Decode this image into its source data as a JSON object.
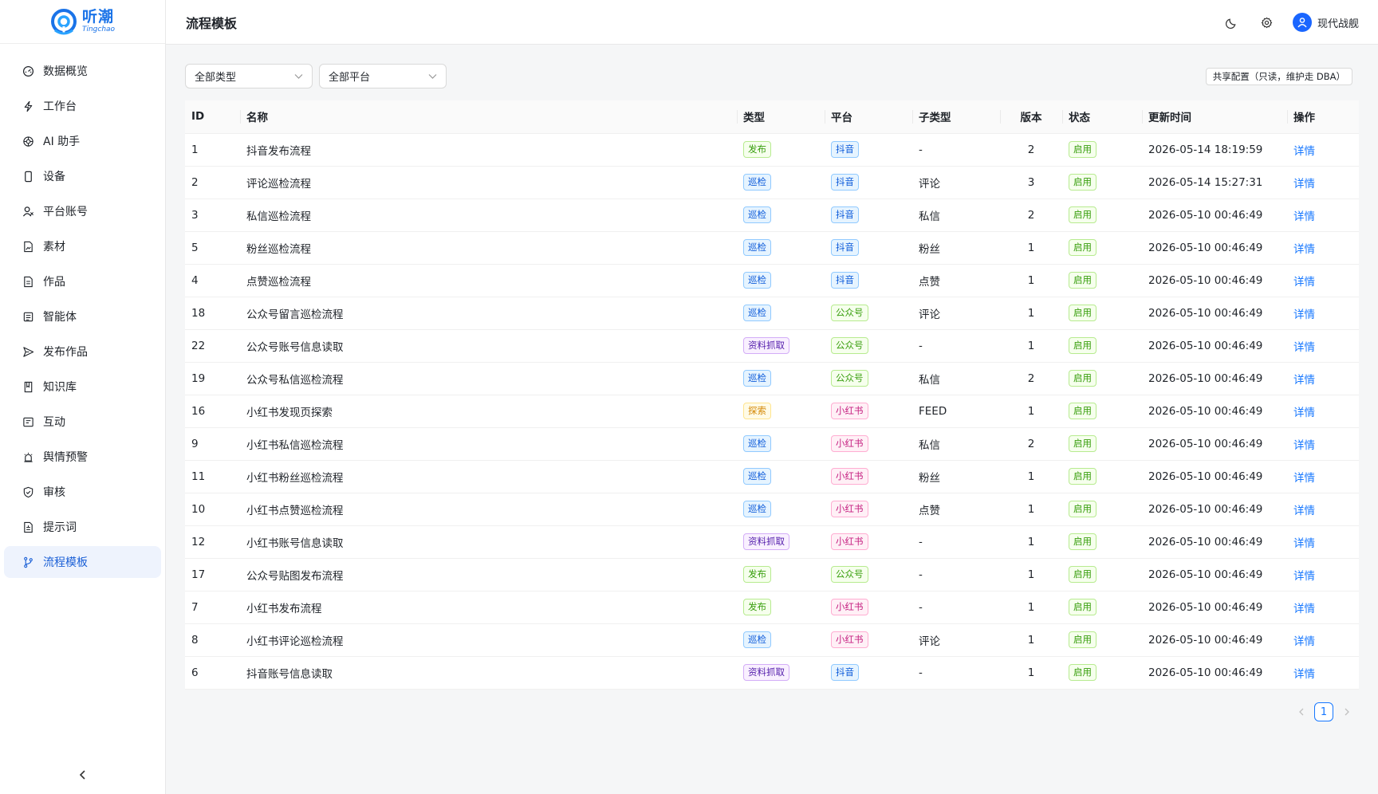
{
  "brand": {
    "name_cn": "听潮",
    "name_en": "Tingchao",
    "color": "#1a73e8"
  },
  "sidebar": {
    "items": [
      {
        "label": "数据概览",
        "icon": "dashboard-icon"
      },
      {
        "label": "工作台",
        "icon": "bolt-icon"
      },
      {
        "label": "AI 助手",
        "icon": "ai-icon"
      },
      {
        "label": "设备",
        "icon": "phone-icon"
      },
      {
        "label": "平台账号",
        "icon": "user-icon"
      },
      {
        "label": "素材",
        "icon": "file-image-icon"
      },
      {
        "label": "作品",
        "icon": "document-icon"
      },
      {
        "label": "智能体",
        "icon": "robot-icon"
      },
      {
        "label": "发布作品",
        "icon": "send-icon"
      },
      {
        "label": "知识库",
        "icon": "book-icon"
      },
      {
        "label": "互动",
        "icon": "message-icon"
      },
      {
        "label": "舆情预警",
        "icon": "alarm-icon"
      },
      {
        "label": "审核",
        "icon": "shield-check-icon"
      },
      {
        "label": "提示词",
        "icon": "prompt-icon"
      },
      {
        "label": "流程模板",
        "icon": "branch-icon",
        "active": true
      }
    ],
    "active_color": "#1a5fd6"
  },
  "header": {
    "title": "流程模板",
    "user_name": "现代战舰",
    "icons": [
      "moon-icon",
      "gear-icon",
      "user-avatar-icon"
    ]
  },
  "filters": {
    "type_value": "全部类型",
    "platform_value": "全部平台",
    "shared_note": "共享配置（只读，维护走 DBA）"
  },
  "table": {
    "columns": [
      "ID",
      "名称",
      "类型",
      "平台",
      "子类型",
      "版本",
      "状态",
      "更新时间",
      "操作"
    ],
    "rows": [
      {
        "id": "1",
        "name": "抖音发布流程",
        "type": "发布",
        "type_color": "green",
        "platform": "抖音",
        "platform_color": "blue",
        "subtype": "-",
        "version": "2",
        "status": "启用",
        "updated": "2026-05-14 18:19:59",
        "action": "详情"
      },
      {
        "id": "2",
        "name": "评论巡检流程",
        "type": "巡检",
        "type_color": "blue",
        "platform": "抖音",
        "platform_color": "blue",
        "subtype": "评论",
        "version": "3",
        "status": "启用",
        "updated": "2026-05-14 15:27:31",
        "action": "详情"
      },
      {
        "id": "3",
        "name": "私信巡检流程",
        "type": "巡检",
        "type_color": "blue",
        "platform": "抖音",
        "platform_color": "blue",
        "subtype": "私信",
        "version": "2",
        "status": "启用",
        "updated": "2026-05-10 00:46:49",
        "action": "详情"
      },
      {
        "id": "5",
        "name": "粉丝巡检流程",
        "type": "巡检",
        "type_color": "blue",
        "platform": "抖音",
        "platform_color": "blue",
        "subtype": "粉丝",
        "version": "1",
        "status": "启用",
        "updated": "2026-05-10 00:46:49",
        "action": "详情"
      },
      {
        "id": "4",
        "name": "点赞巡检流程",
        "type": "巡检",
        "type_color": "blue",
        "platform": "抖音",
        "platform_color": "blue",
        "subtype": "点赞",
        "version": "1",
        "status": "启用",
        "updated": "2026-05-10 00:46:49",
        "action": "详情"
      },
      {
        "id": "18",
        "name": "公众号留言巡检流程",
        "type": "巡检",
        "type_color": "blue",
        "platform": "公众号",
        "platform_color": "green",
        "subtype": "评论",
        "version": "1",
        "status": "启用",
        "updated": "2026-05-10 00:46:49",
        "action": "详情"
      },
      {
        "id": "22",
        "name": "公众号账号信息读取",
        "type": "资料抓取",
        "type_color": "purple",
        "platform": "公众号",
        "platform_color": "green",
        "subtype": "-",
        "version": "1",
        "status": "启用",
        "updated": "2026-05-10 00:46:49",
        "action": "详情"
      },
      {
        "id": "19",
        "name": "公众号私信巡检流程",
        "type": "巡检",
        "type_color": "blue",
        "platform": "公众号",
        "platform_color": "green",
        "subtype": "私信",
        "version": "2",
        "status": "启用",
        "updated": "2026-05-10 00:46:49",
        "action": "详情"
      },
      {
        "id": "16",
        "name": "小红书发现页探索",
        "type": "探索",
        "type_color": "orange",
        "platform": "小红书",
        "platform_color": "magenta",
        "subtype": "FEED",
        "version": "1",
        "status": "启用",
        "updated": "2026-05-10 00:46:49",
        "action": "详情"
      },
      {
        "id": "9",
        "name": "小红书私信巡检流程",
        "type": "巡检",
        "type_color": "blue",
        "platform": "小红书",
        "platform_color": "magenta",
        "subtype": "私信",
        "version": "2",
        "status": "启用",
        "updated": "2026-05-10 00:46:49",
        "action": "详情"
      },
      {
        "id": "11",
        "name": "小红书粉丝巡检流程",
        "type": "巡检",
        "type_color": "blue",
        "platform": "小红书",
        "platform_color": "magenta",
        "subtype": "粉丝",
        "version": "1",
        "status": "启用",
        "updated": "2026-05-10 00:46:49",
        "action": "详情"
      },
      {
        "id": "10",
        "name": "小红书点赞巡检流程",
        "type": "巡检",
        "type_color": "blue",
        "platform": "小红书",
        "platform_color": "magenta",
        "subtype": "点赞",
        "version": "1",
        "status": "启用",
        "updated": "2026-05-10 00:46:49",
        "action": "详情"
      },
      {
        "id": "12",
        "name": "小红书账号信息读取",
        "type": "资料抓取",
        "type_color": "purple",
        "platform": "小红书",
        "platform_color": "magenta",
        "subtype": "-",
        "version": "1",
        "status": "启用",
        "updated": "2026-05-10 00:46:49",
        "action": "详情"
      },
      {
        "id": "17",
        "name": "公众号贴图发布流程",
        "type": "发布",
        "type_color": "green",
        "platform": "公众号",
        "platform_color": "green",
        "subtype": "-",
        "version": "1",
        "status": "启用",
        "updated": "2026-05-10 00:46:49",
        "action": "详情"
      },
      {
        "id": "7",
        "name": "小红书发布流程",
        "type": "发布",
        "type_color": "green",
        "platform": "小红书",
        "platform_color": "magenta",
        "subtype": "-",
        "version": "1",
        "status": "启用",
        "updated": "2026-05-10 00:46:49",
        "action": "详情"
      },
      {
        "id": "8",
        "name": "小红书评论巡检流程",
        "type": "巡检",
        "type_color": "blue",
        "platform": "小红书",
        "platform_color": "magenta",
        "subtype": "评论",
        "version": "1",
        "status": "启用",
        "updated": "2026-05-10 00:46:49",
        "action": "详情"
      },
      {
        "id": "6",
        "name": "抖音账号信息读取",
        "type": "资料抓取",
        "type_color": "purple",
        "platform": "抖音",
        "platform_color": "blue",
        "subtype": "-",
        "version": "1",
        "status": "启用",
        "updated": "2026-05-10 00:46:49",
        "action": "详情"
      }
    ]
  },
  "pagination": {
    "current": "1"
  }
}
